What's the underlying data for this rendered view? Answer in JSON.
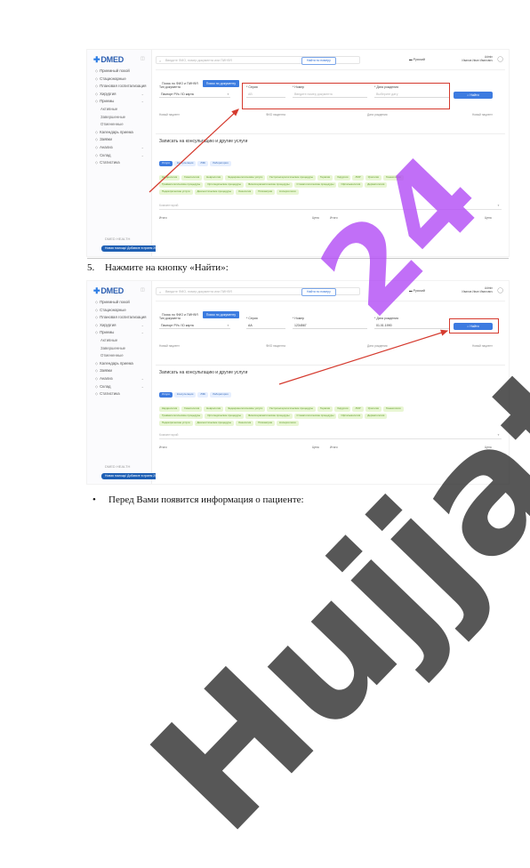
{
  "doc": {
    "step5": {
      "num": "5.",
      "text": "Нажмите на кнопку «Найти»:"
    },
    "bullet": {
      "symbol": "•",
      "text": "Перед Вами появится информация о пациенте:"
    }
  },
  "watermarks": {
    "black": "Hujjat",
    "purple": "24"
  },
  "app": {
    "logo": "DMED",
    "sidebar": [
      {
        "label": "Приемный покой",
        "icon": "hospital-icon"
      },
      {
        "label": "Стационарные",
        "icon": "bed-icon"
      },
      {
        "label": "Плановая госпитализация",
        "icon": "calendar-icon"
      },
      {
        "label": "Хирургия",
        "icon": "scalpel-icon",
        "chevron": true
      },
      {
        "label": "Приемы",
        "icon": "clipboard-icon",
        "chevron": true
      },
      {
        "label": "Активные",
        "sub": true
      },
      {
        "label": "Завершенные",
        "sub": true
      },
      {
        "label": "Отмененные",
        "sub": true
      },
      {
        "label": "Календарь приема",
        "icon": "calendar-icon"
      },
      {
        "label": "Заявки",
        "icon": "request-icon"
      },
      {
        "label": "Анализ",
        "icon": "flask-icon",
        "chevron": true
      },
      {
        "label": "Склад",
        "icon": "box-icon",
        "chevron": true
      },
      {
        "label": "Статистика",
        "icon": "chart-icon"
      }
    ],
    "brand_sub": "DMED HEALTH",
    "bottom_pill": "Новая помощь! Добавьте в прием",
    "bottom_pill_count": "20",
    "search_placeholder": "Введите ФИО, номер документа или ПИНФЛ",
    "find_uni_button": "Найти по номеру",
    "language": "Русский",
    "user_line1": "Admin",
    "user_line2": "Иванов Иван Иванович",
    "tabs": [
      "Поиск по ФИО и ПИНФЛ",
      "Поиск по документу"
    ],
    "form": {
      "doctype_label": "Тип документа",
      "doctype_value": "Паспорт РУз / ID карта",
      "series_label": "* Серия",
      "series_placeholder": "AB",
      "series_value": "AA",
      "number_label": "* Номер",
      "number_placeholder": "Введите номер документа",
      "number_value": "1234567",
      "birthdate_label": "* Дата рождения",
      "birthdate_placeholder": "Выберите дату",
      "birthdate_value": "01.01.1990",
      "find_button": "Найти",
      "hint_left": "Новый пациент",
      "hint_mid": "ФИО пациента",
      "hint_right1": "Дата рождения",
      "hint_right2": "Новый пациент"
    },
    "services": {
      "title": "Записать на консультацию и другие услуги",
      "tab_chips": [
        "Услуги",
        "Консультации",
        "ЛФК",
        "Лаборатория"
      ],
      "green_chips_1": [
        "Кардиология",
        "Гематология",
        "Неврология",
        "Эндокринологические услуги",
        "Гастроэнтерологические процедуры",
        "Терапия",
        "Хирургия",
        "ЛОР",
        "Урология",
        "Гинекология"
      ],
      "green_chips_2": [
        "Травматологические процедуры",
        "Ортопедические процедуры",
        "Физиотерапевтические процедуры",
        "Стоматологические процедуры",
        "Офтальмология",
        "Дерматология"
      ],
      "green_chips_3": [
        "Педиатрические услуги",
        "Диагностические процедуры",
        "Онкология",
        "Психиатрия",
        "Аллергология"
      ],
      "comment_placeholder": "Комментарий",
      "total_left": "Итого:",
      "price_label": "Цена",
      "total_right": "Итого:",
      "price_label_2": "Цена"
    }
  },
  "colors": {
    "highlight": "#d53a2e",
    "primary": "#3d7be0",
    "chip_green_bg": "#e8f6d3",
    "watermark_purple": "#af46f5"
  }
}
